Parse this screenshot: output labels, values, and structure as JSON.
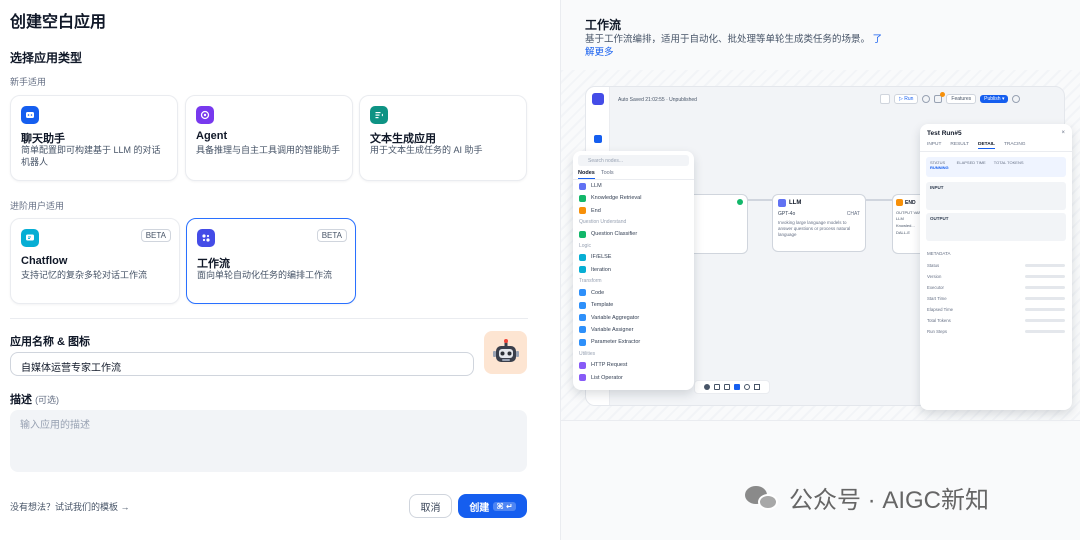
{
  "page": {
    "title": "创建空白应用"
  },
  "left": {
    "choose_type": "选择应用类型",
    "beginner_label": "新手适用",
    "advanced_label": "进阶用户适用",
    "beginner_cards": [
      {
        "name": "聊天助手",
        "desc": "简单配置即可构建基于 LLM 的对话机器人",
        "icon": "chat-bot-icon",
        "color": "#155eef"
      },
      {
        "name": "Agent",
        "desc": "具备推理与自主工具调用的智能助手",
        "icon": "agent-icon",
        "color": "#7839ee"
      },
      {
        "name": "文本生成应用",
        "desc": "用于文本生成任务的 AI 助手",
        "icon": "text-gen-icon",
        "color": "#0e9384"
      }
    ],
    "advanced_cards": [
      {
        "name": "Chatflow",
        "desc": "支持记忆的复杂多轮对话工作流",
        "badge": "BETA",
        "icon": "chatflow-icon",
        "color": "#06aed4"
      },
      {
        "name": "工作流",
        "desc": "面向单轮自动化任务的编排工作流",
        "badge": "BETA",
        "icon": "workflow-icon",
        "color": "#444ce7"
      }
    ],
    "name_label": "应用名称 & 图标",
    "name_value": "自媒体运营专家工作流",
    "desc_label": "描述",
    "desc_optional": "(可选)",
    "desc_placeholder": "输入应用的描述",
    "template_link": "没有想法？试试我们的模板 →",
    "cancel": "取消",
    "create": "创建",
    "create_shortcut": "⌘ ↵"
  },
  "right": {
    "title": "工作流",
    "desc": "基于工作流编排，适用于自动化、批处理等单轮生成类任务的场景。",
    "learn_more": "了解更多",
    "preview": {
      "app_name": "Auto Saved 21:02:55 · Unpublished",
      "run": "Run",
      "features": "Features",
      "publish": "Publish ▾",
      "search": "Search nodes...",
      "tabs": [
        "Nodes",
        "Tools"
      ],
      "groups": [
        {
          "header": "",
          "items": [
            "LLM",
            "Knowledge Retrieval",
            "End"
          ]
        },
        {
          "header": "Question Understand",
          "items": [
            "Question Classifier"
          ]
        },
        {
          "header": "Logic",
          "items": [
            "IF/ELSE",
            "Iteration"
          ]
        },
        {
          "header": "Transform",
          "items": [
            "Code",
            "Template",
            "Variable Aggregator",
            "Variable Assigner",
            "Parameter Extractor"
          ]
        },
        {
          "header": "Utilities",
          "items": [
            "HTTP Request",
            "List Operator"
          ]
        }
      ],
      "llm_node": {
        "title": "LLM",
        "model": "GPT-4o",
        "tag": "CHAT",
        "desc": "Invoking large language models to answer questions or process natural language"
      },
      "end_node": {
        "title": "END",
        "output": "OUTPUT VARI...",
        "items": [
          "LLM",
          "Knowled...",
          "DALL-E"
        ]
      },
      "test_panel": {
        "title": "Test Run#5",
        "tabs": [
          "INPUT",
          "RESULT",
          "DETAIL",
          "TRACING"
        ],
        "status_label": "STATUS",
        "status": "RUNNING",
        "elapsed_label": "ELAPSED TIME",
        "tokens_label": "TOTAL TOKENS",
        "input_label": "INPUT",
        "output_label": "OUTPUT",
        "metadata_label": "METADATA",
        "meta_rows": [
          "Status",
          "Version",
          "Executor",
          "Start Time",
          "Elapsed Time",
          "Total Tokens",
          "Run Steps"
        ]
      }
    }
  },
  "watermark": "公众号 · AIGC新知"
}
